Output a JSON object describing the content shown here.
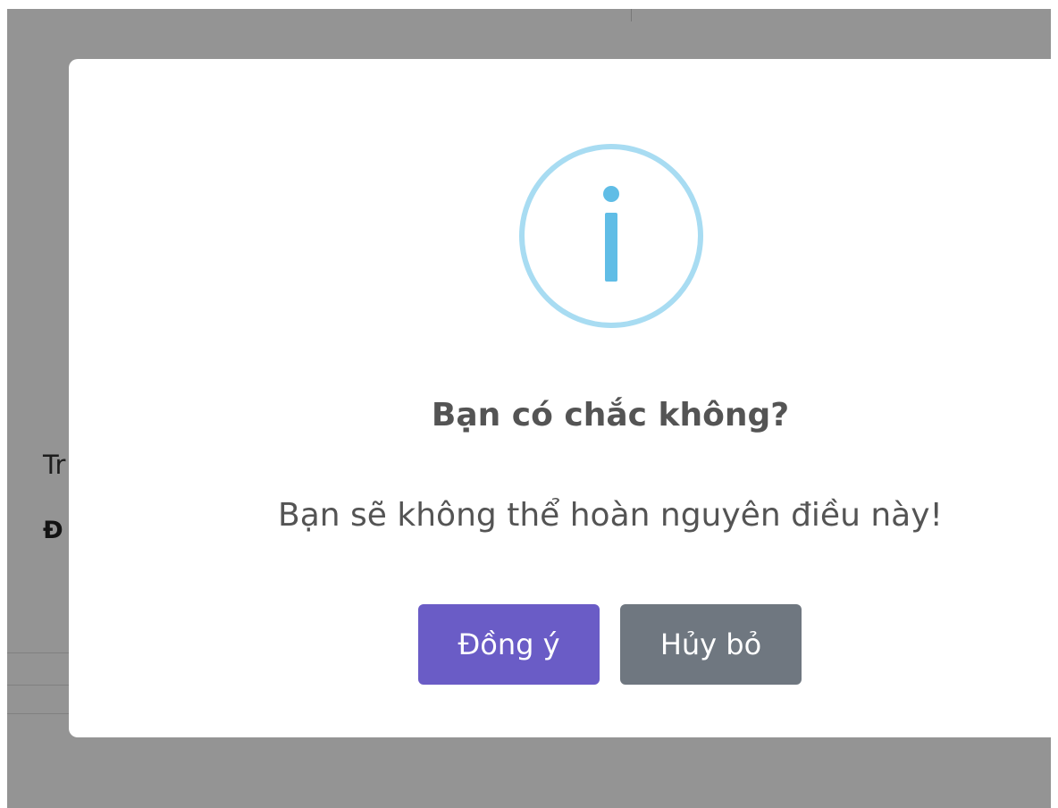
{
  "background": {
    "row_label_1": "Tr",
    "row_label_2": "Đ"
  },
  "dialog": {
    "icon": "info-icon",
    "icon_glyph": "i",
    "title": "Bạn có chắc không?",
    "message": "Bạn sẽ không thể hoàn nguyên điều này!",
    "confirm_label": "Đồng ý",
    "cancel_label": "Hủy bỏ"
  },
  "colors": {
    "overlay": "#9a9a9a",
    "icon_ring": "#a8dcf2",
    "icon_mark": "#60bde6",
    "confirm_button": "#6a5cc6",
    "cancel_button": "#6f7780",
    "text": "#545454"
  }
}
